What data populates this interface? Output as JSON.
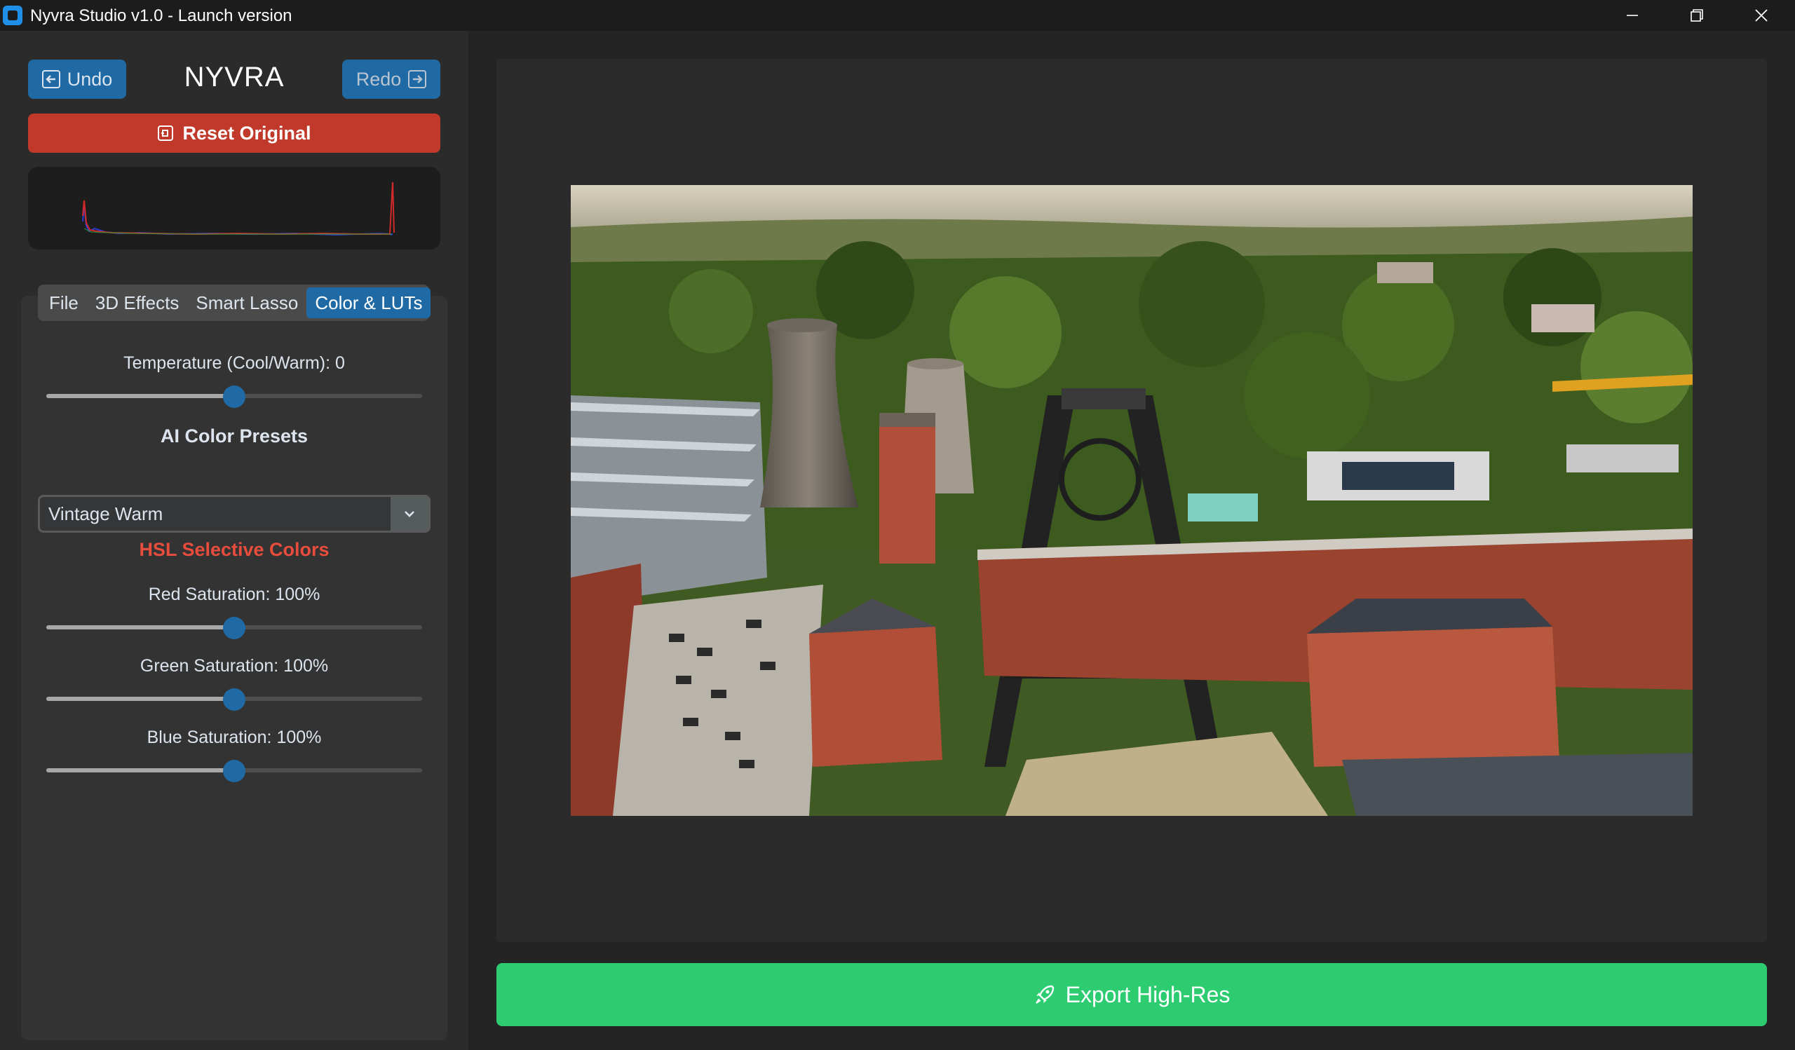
{
  "window": {
    "title": "Nyvra Studio v1.0 - Launch version"
  },
  "toolbar": {
    "undo_label": "Undo",
    "redo_label": "Redo",
    "brand": "NYVRA",
    "reset_label": "Reset Original"
  },
  "tabs": [
    {
      "label": "File",
      "active": false
    },
    {
      "label": "3D Effects",
      "active": false
    },
    {
      "label": "Smart Lasso",
      "active": false
    },
    {
      "label": "Color & LUTs",
      "active": true
    }
  ],
  "color": {
    "temperature_label": "Temperature (Cool/Warm): 0",
    "temperature_value": 0.5,
    "presets_heading": "AI Color Presets",
    "preset_selected": "Vintage Warm",
    "hsl_heading": "HSL Selective Colors",
    "red_label": "Red Saturation: 100%",
    "red_value": 0.5,
    "green_label": "Green Saturation: 100%",
    "green_value": 0.5,
    "blue_label": "Blue Saturation: 100%",
    "blue_value": 0.5
  },
  "export": {
    "label": "Export High-Res"
  },
  "colors": {
    "accent": "#1f6aa5",
    "danger": "#c0392b",
    "success": "#2ecc71",
    "hsl_heading": "#e74c3c"
  },
  "icons": [
    "app-icon",
    "minimize-icon",
    "maximize-icon",
    "close-icon",
    "undo-arrow-icon",
    "redo-arrow-icon",
    "reset-icon",
    "chevron-down-icon",
    "rocket-icon"
  ]
}
